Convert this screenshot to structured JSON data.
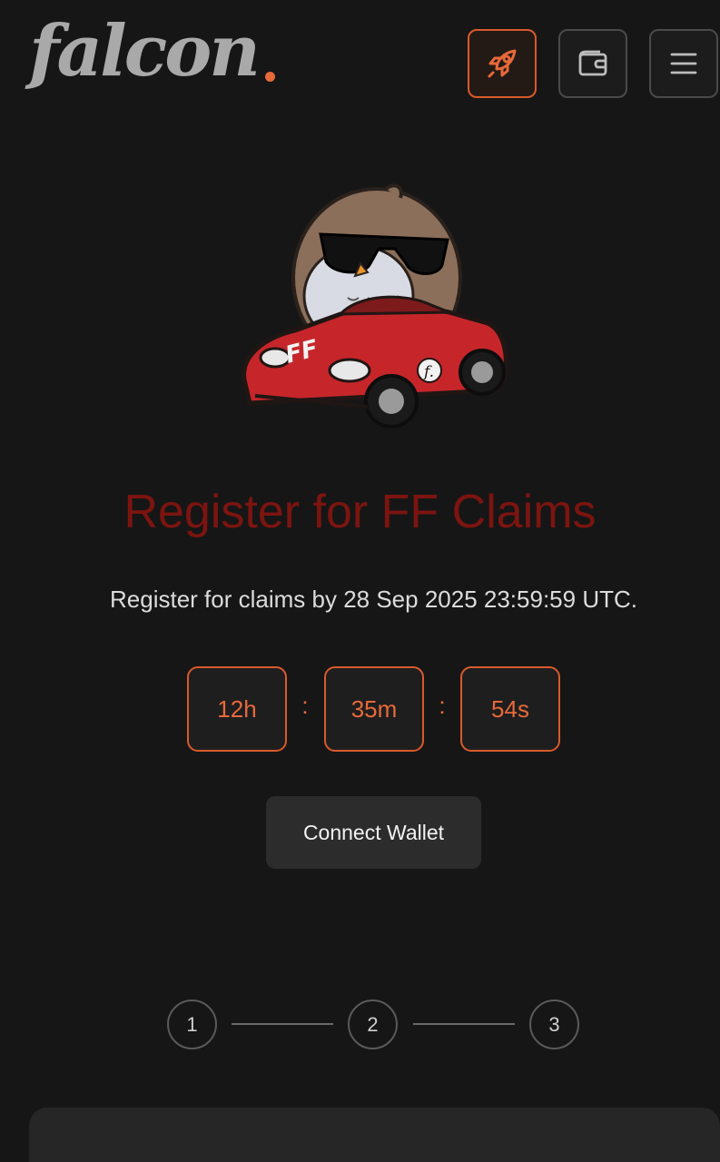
{
  "header": {
    "logo_text": "falcon",
    "accent_color": "#e8693a",
    "icons": [
      "rocket-icon",
      "wallet-icon",
      "menu-icon"
    ]
  },
  "hero": {
    "mascot_plate_text": "FF",
    "mascot_badge_text": "f.",
    "title": "Register for FF Claims",
    "subtitle": "Register for claims by 28 Sep 2025 23:59:59 UTC."
  },
  "countdown": {
    "hours": "12h",
    "minutes": "35m",
    "seconds": "54s",
    "separator": ":"
  },
  "connect_label": "Connect Wallet",
  "steps": [
    "1",
    "2",
    "3"
  ]
}
